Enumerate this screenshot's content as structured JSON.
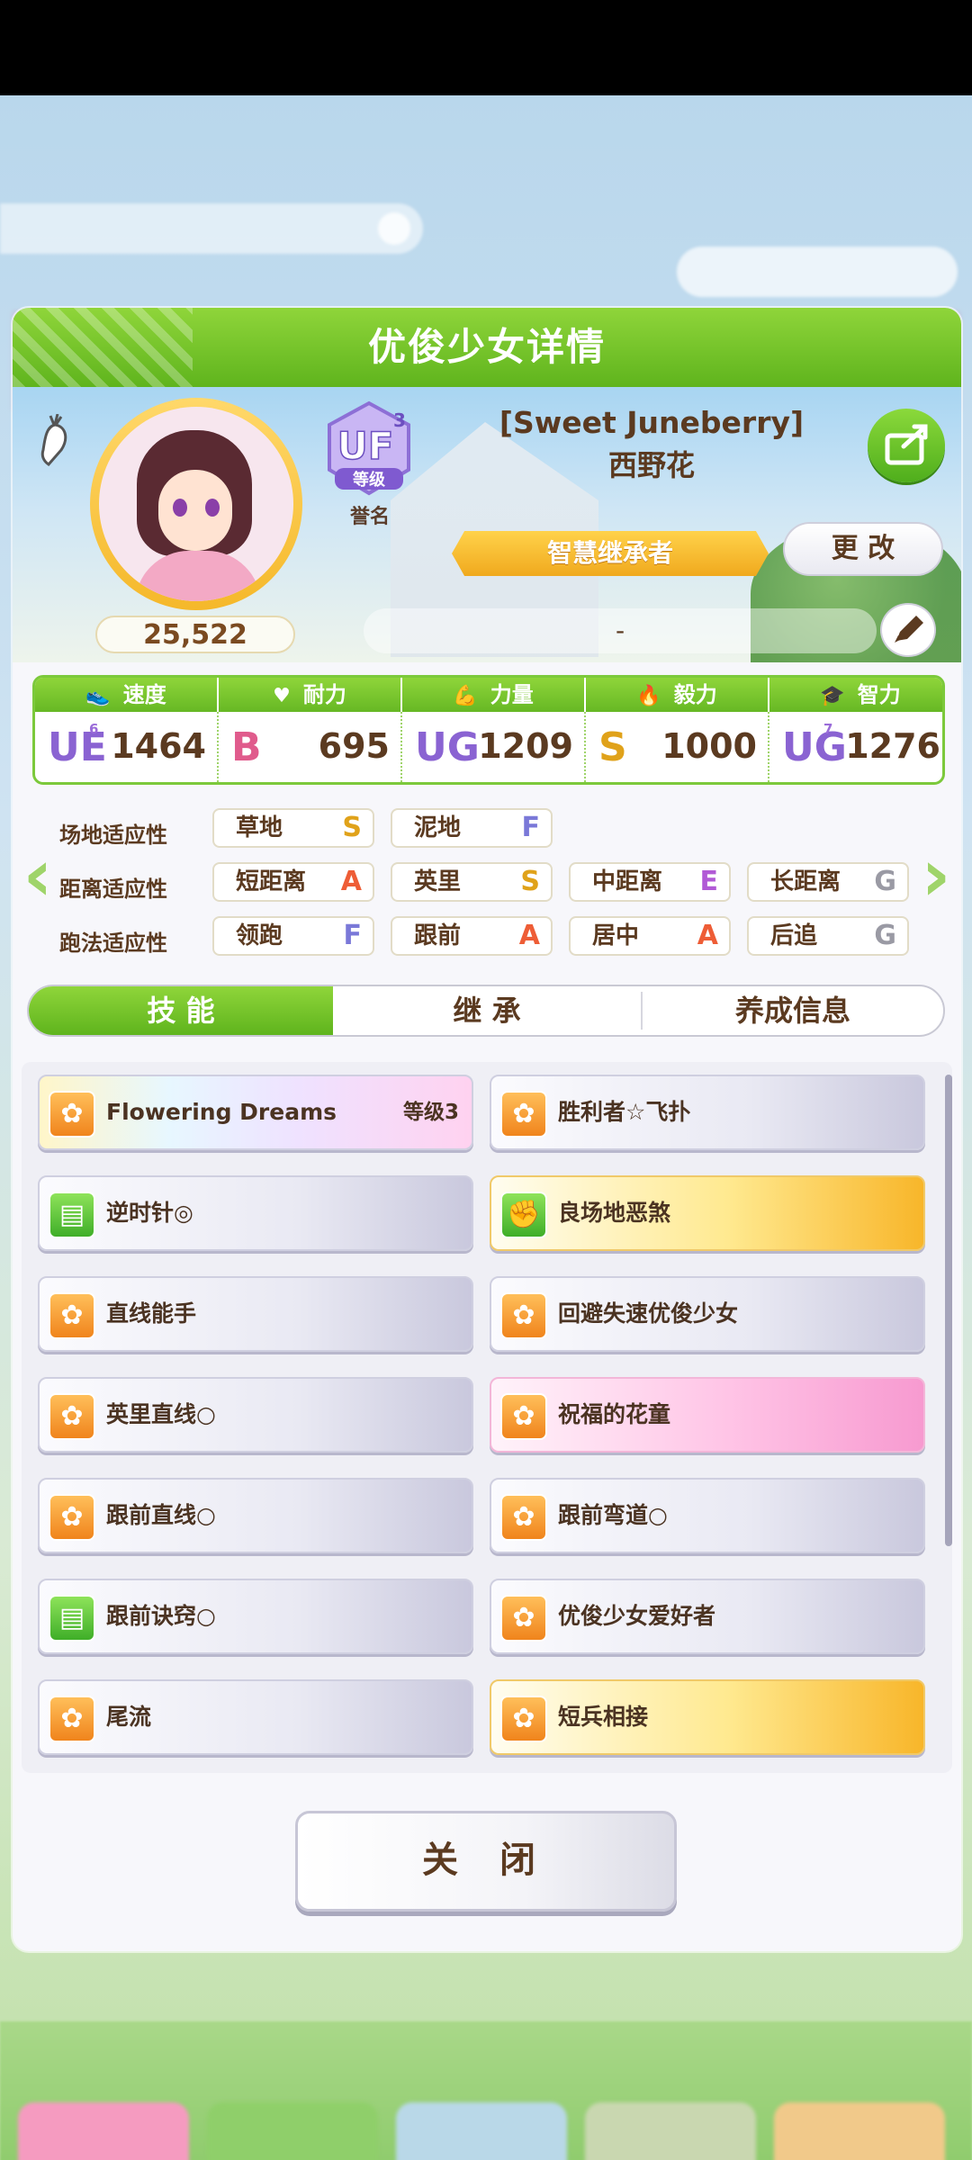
{
  "background": {
    "search_placeholder": "",
    "button_label": ""
  },
  "panel": {
    "title": "优俊少女详情"
  },
  "profile": {
    "score": "25,522",
    "rank": {
      "grade": "UF",
      "sub": "3",
      "badge_text": "等级",
      "label": "誉名"
    },
    "name_en": "[Sweet Juneberry]",
    "name_cn": "西野花",
    "title": "智慧继承者",
    "change_label": "更 改",
    "nickname_value": "-"
  },
  "stats": [
    {
      "label": "速度",
      "grade": "UE",
      "sub": "6",
      "value": "1464",
      "icon": "shoe-icon"
    },
    {
      "label": "耐力",
      "grade": "B",
      "sub": "",
      "value": "695",
      "icon": "heart-icon"
    },
    {
      "label": "力量",
      "grade": "UG",
      "sub": "",
      "value": "1209",
      "icon": "arm-icon"
    },
    {
      "label": "毅力",
      "grade": "S",
      "sub": "",
      "value": "1000",
      "icon": "flame-icon"
    },
    {
      "label": "智力",
      "grade": "UG",
      "sub": "7",
      "value": "1276",
      "icon": "graduation-cap-icon"
    }
  ],
  "aptitude": {
    "track": {
      "label": "场地适应性",
      "items": [
        {
          "name": "草地",
          "grade": "S"
        },
        {
          "name": "泥地",
          "grade": "F"
        }
      ]
    },
    "distance": {
      "label": "距离适应性",
      "items": [
        {
          "name": "短距离",
          "grade": "A"
        },
        {
          "name": "英里",
          "grade": "S"
        },
        {
          "name": "中距离",
          "grade": "E"
        },
        {
          "name": "长距离",
          "grade": "G"
        }
      ]
    },
    "style": {
      "label": "跑法适应性",
      "items": [
        {
          "name": "领跑",
          "grade": "F"
        },
        {
          "name": "跟前",
          "grade": "A"
        },
        {
          "name": "居中",
          "grade": "A"
        },
        {
          "name": "后追",
          "grade": "G"
        }
      ]
    }
  },
  "tabs": [
    {
      "label": "技 能",
      "active": true
    },
    {
      "label": "继 承",
      "active": false
    },
    {
      "label": "养成信息",
      "active": false
    }
  ],
  "skills": [
    {
      "name": "Flowering Dreams",
      "level": "等级3",
      "style": "rainbow",
      "icon": "orange"
    },
    {
      "name": "胜利者☆飞扑",
      "level": "",
      "style": "white",
      "icon": "orange"
    },
    {
      "name": "逆时针◎",
      "level": "",
      "style": "white",
      "icon": "green"
    },
    {
      "name": "良场地恶煞",
      "level": "",
      "style": "gold",
      "icon": "green"
    },
    {
      "name": "直线能手",
      "level": "",
      "style": "white",
      "icon": "orange"
    },
    {
      "name": "回避失速优俊少女",
      "level": "",
      "style": "white",
      "icon": "orange"
    },
    {
      "name": "英里直线○",
      "level": "",
      "style": "white",
      "icon": "orange"
    },
    {
      "name": "祝福的花童",
      "level": "",
      "style": "pink",
      "icon": "orange"
    },
    {
      "name": "跟前直线○",
      "level": "",
      "style": "white",
      "icon": "orange"
    },
    {
      "name": "跟前弯道○",
      "level": "",
      "style": "white",
      "icon": "orange"
    },
    {
      "name": "跟前诀窍○",
      "level": "",
      "style": "white",
      "icon": "green"
    },
    {
      "name": "优俊少女爱好者",
      "level": "",
      "style": "white",
      "icon": "orange"
    },
    {
      "name": "尾流",
      "level": "",
      "style": "white",
      "icon": "orange"
    },
    {
      "name": "短兵相接",
      "level": "",
      "style": "gold",
      "icon": "orange"
    }
  ],
  "close_label": "关 闭",
  "colors": {
    "accent_green": "#6cc424",
    "text_brown": "#5b3a20"
  }
}
